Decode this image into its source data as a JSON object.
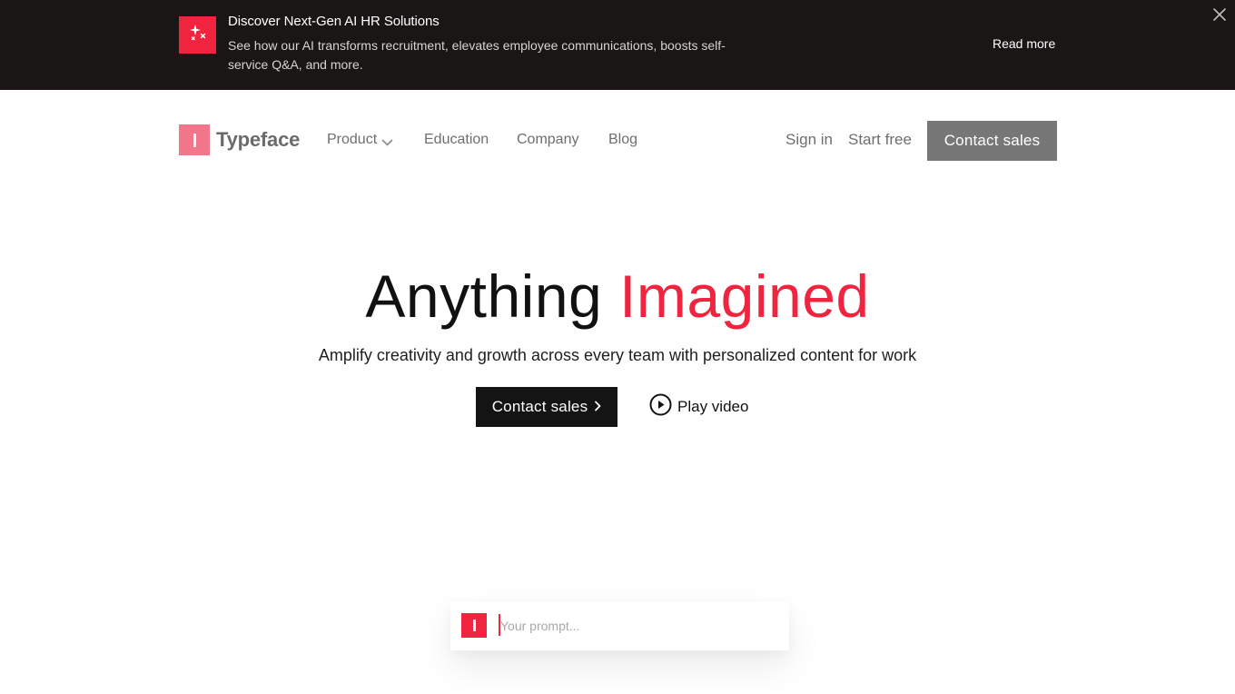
{
  "banner": {
    "badge_icon": "sparkle-icon",
    "title": "Discover Next-Gen AI HR Solutions",
    "description": "See how our AI transforms recruitment, elevates employee communications, boosts self-service Q&A, and more.",
    "read_more": "Read more",
    "close_icon": "close-icon",
    "accent": "#f0243f",
    "background": "#1b1616"
  },
  "nav": {
    "logo_text": "Typeface",
    "links": [
      "Product",
      "Education",
      "Company",
      "Blog"
    ],
    "product_dropdown_icon": "chevron-down-icon",
    "sign_in": "Sign in",
    "start_free": "Start free",
    "contact_sales": "Contact sales"
  },
  "hero": {
    "title_part1": "Anything",
    "title_part2": "Imagined",
    "subtitle": "Amplify creativity and growth across every team with personalized content for work",
    "cta_primary": "Contact sales",
    "cta_primary_icon": "chevron-right-icon",
    "cta_secondary": "Play video",
    "cta_secondary_icon": "play-circle-icon",
    "accent": "#f0243f"
  },
  "prompt": {
    "placeholder": "Your prompt...",
    "value": ""
  }
}
